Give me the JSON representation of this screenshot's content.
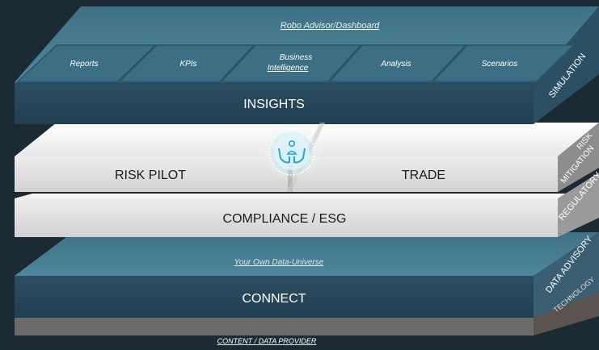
{
  "insights": {
    "dashboard_label": "Robo Advisor/Dashboard",
    "tiles": [
      "Reports",
      "KPIs",
      "Business",
      "Intelligence",
      "Analysis",
      "Scenarios"
    ],
    "title": "INSIGHTS",
    "side_label": "SIMULATION"
  },
  "middle": {
    "risk_pilot": "RISK PILOT",
    "trade": "TRADE",
    "side_label_1": "RISK",
    "side_label_2": "MITIGATION"
  },
  "compliance": {
    "title": "COMPLIANCE / ESG",
    "side_label": "REGULATORY"
  },
  "connect": {
    "universe_label": "Your Own Data-Universe",
    "title": "CONNECT",
    "side_label_1": "DATA ADVISORY",
    "side_label_2": "TECHNOLOGY",
    "footer_label": "CONTENT / DATA PROVIDER"
  },
  "colors": {
    "background": "#1b2a33",
    "teal_top": "#4a7e92",
    "teal_front": "#274a5e",
    "white_front": "#dcdcdc",
    "accent_icon": "#2aa6c4"
  },
  "icon": "hands-holding-person-icon"
}
